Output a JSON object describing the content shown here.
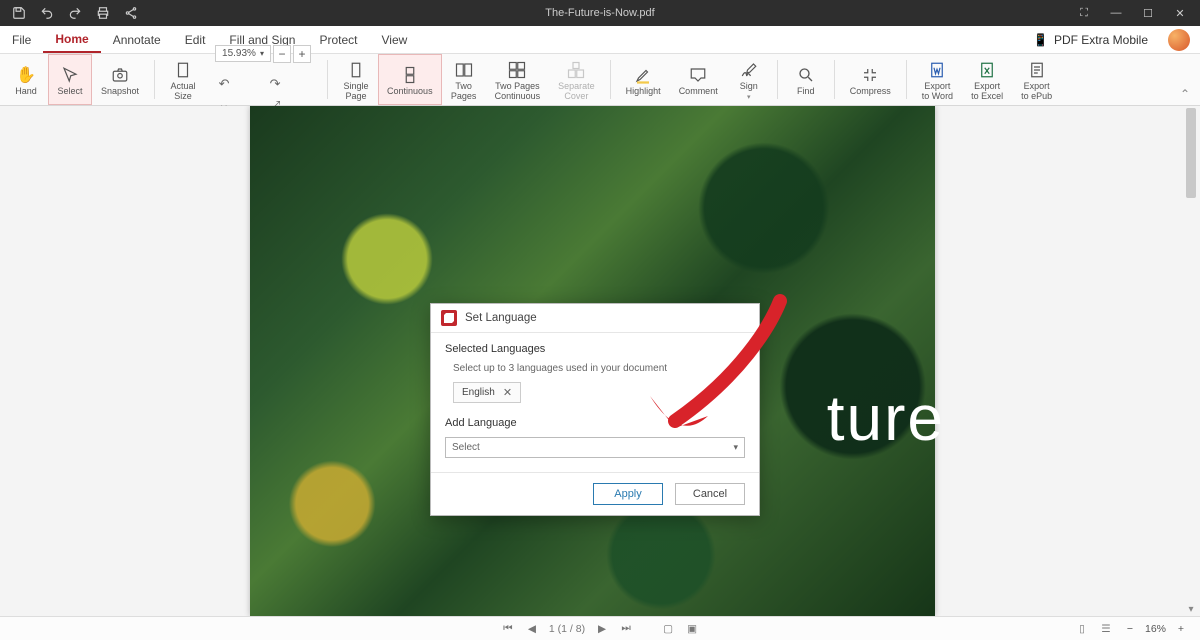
{
  "titlebar": {
    "document_name": "The-Future-is-Now.pdf"
  },
  "menubar": {
    "items": [
      {
        "label": "File"
      },
      {
        "label": "Home",
        "active": true
      },
      {
        "label": "Annotate"
      },
      {
        "label": "Edit"
      },
      {
        "label": "Fill and Sign"
      },
      {
        "label": "Protect"
      },
      {
        "label": "View"
      }
    ],
    "mobile_label": "PDF Extra Mobile"
  },
  "ribbon": {
    "hand": "Hand",
    "select": "Select",
    "snapshot": "Snapshot",
    "actual_size": "Actual\nSize",
    "zoom_value": "15.93%",
    "single_page": "Single\nPage",
    "continuous": "Continuous",
    "two_pages": "Two\nPages",
    "two_pages_cont": "Two Pages\nContinuous",
    "separate_cover": "Separate\nCover",
    "highlight": "Highlight",
    "comment": "Comment",
    "sign": "Sign",
    "find": "Find",
    "compress": "Compress",
    "export_word": "Export\nto Word",
    "export_excel": "Export\nto Excel",
    "export_epub": "Export\nto ePub"
  },
  "page": {
    "hero_text": "ture"
  },
  "dialog": {
    "title": "Set Language",
    "section_selected": "Selected Languages",
    "hint": "Select up to 3 languages used in your document",
    "chip_lang": "English",
    "section_add": "Add Language",
    "select_placeholder": "Select",
    "apply": "Apply",
    "cancel": "Cancel"
  },
  "status": {
    "page_display": "1 (1 / 8)",
    "zoom_label": "16%"
  }
}
